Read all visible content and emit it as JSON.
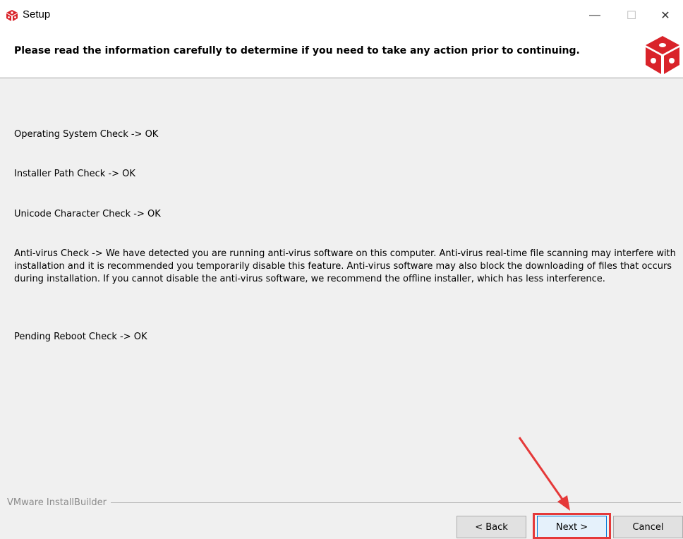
{
  "window": {
    "title": "Setup",
    "controls": {
      "minimize": "—",
      "maximize": "☐",
      "close": "✕"
    }
  },
  "header": {
    "text": "Please read the information carefully to determine if you need to take any action prior to continuing."
  },
  "checks": [
    "Operating System Check -> OK",
    "Installer Path Check -> OK",
    "Unicode Character Check ->  OK",
    "Anti-virus Check -> We have detected you are running anti-virus software on this computer. Anti-virus real-time file scanning may interfere with installation and it is recommended you temporarily disable this feature. Anti-virus software may also block the downloading of files that occurs during installation. If you cannot disable the anti-virus software, we recommend the offline installer, which has less interference.",
    "Pending Reboot Check -> OK"
  ],
  "footer": {
    "brand": "VMware InstallBuilder",
    "back_label": "< Back",
    "next_label": "Next >",
    "cancel_label": "Cancel"
  },
  "annotation": {
    "highlight_color": "#e53939",
    "arrow_color": "#e53939"
  },
  "icons": {
    "app": "red-cube-icon",
    "logo": "red-cube-logo-icon"
  }
}
